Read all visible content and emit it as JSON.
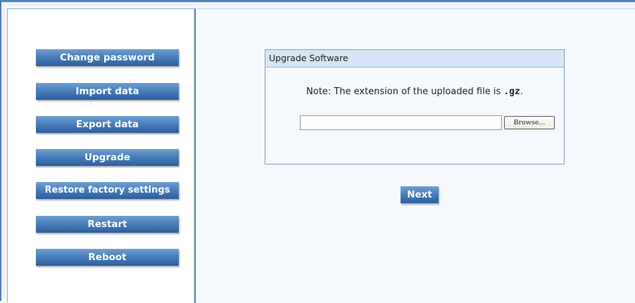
{
  "sidebar": {
    "items": [
      {
        "label": "Change password"
      },
      {
        "label": "Import data"
      },
      {
        "label": "Export data"
      },
      {
        "label": "Upgrade"
      },
      {
        "label": "Restore factory settings"
      },
      {
        "label": "Restart"
      },
      {
        "label": "Reboot"
      }
    ]
  },
  "panel": {
    "title": "Upgrade Software",
    "note_prefix": "Note: The extension of the uploaded file is ",
    "note_ext": ".gz",
    "note_suffix": ".",
    "file_value": "",
    "browse_label": "Browse..."
  },
  "actions": {
    "next_label": "Next"
  },
  "colors": {
    "button_blue": "#4a7fbc",
    "border_blue": "#4f7fb8",
    "panel_header": "#d6e5f5"
  }
}
